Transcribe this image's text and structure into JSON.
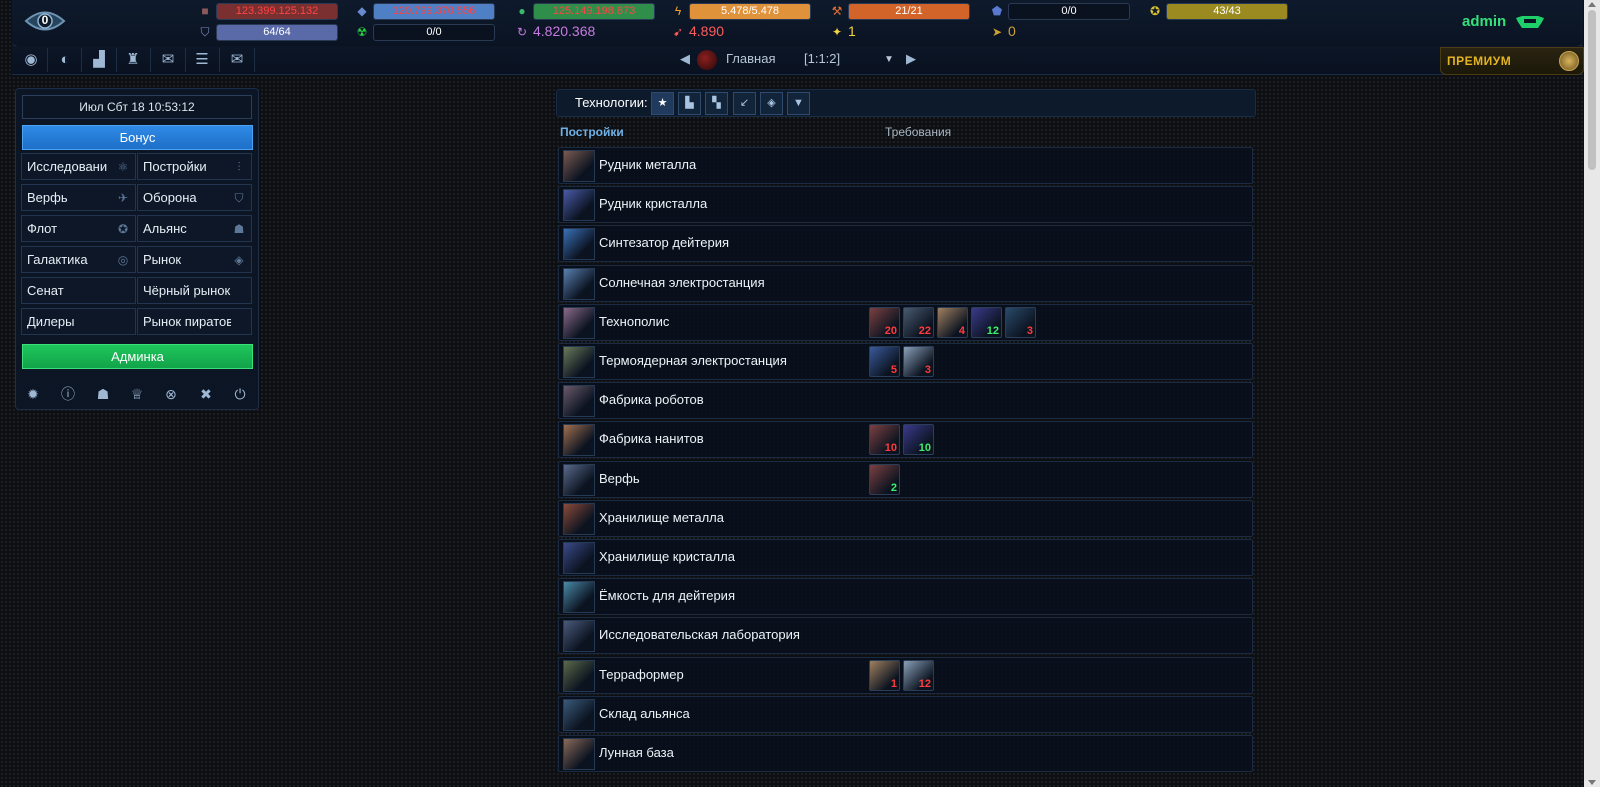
{
  "header": {
    "notifications": "0",
    "user": "admin",
    "resources_row1": [
      {
        "icon": "metal-icon",
        "text": "123.399.125.132",
        "color": "#ff4444",
        "fill": 1.0,
        "fill_color": "#7a3030"
      },
      {
        "icon": "crystal-icon",
        "text": "120.799.370.556",
        "color": "#ff4444",
        "fill": 1.0,
        "fill_color": "#4f7fc4"
      },
      {
        "icon": "deuterium-icon",
        "text": "125.149.198.873",
        "color": "#ff4444",
        "fill": 1.0,
        "fill_color": "#2f8f4a"
      },
      {
        "icon": "energy-icon",
        "text": "5.478/5.478",
        "color": "#ffffff",
        "fill": 1.0,
        "fill_color": "#e0923a"
      },
      {
        "icon": "fields-icon",
        "text": "21/21",
        "color": "#ffffff",
        "fill": 1.0,
        "fill_color": "#d2642a"
      },
      {
        "icon": "pentagon-icon",
        "text": "0/0",
        "color": "#ffffff",
        "fill": 0,
        "fill_color": "#1e2f4c"
      },
      {
        "icon": "target-icon",
        "text": "43/43",
        "color": "#ffffff",
        "fill": 1.0,
        "fill_color": "#9a8a1f"
      }
    ],
    "resources_row2": [
      {
        "icon": "shield-icon",
        "text": "64/64",
        "type": "bar",
        "fill": 1.0,
        "fill_color": "#5a6aa8",
        "color": "#ffffff"
      },
      {
        "icon": "radiation-icon",
        "text": "0/0",
        "type": "bar",
        "fill": 0,
        "fill_color": "#1e2f4c",
        "color": "#ffffff"
      },
      {
        "icon": "darkmatter-icon",
        "text": "4.820.368",
        "type": "plain",
        "color": "#c67be0"
      },
      {
        "icon": "rocket-icon",
        "text": "4.890",
        "type": "plain",
        "color": "#ff5a5a"
      },
      {
        "icon": "star-shard-icon",
        "text": "1",
        "type": "plain",
        "color": "#f2d240"
      },
      {
        "icon": "arrow-icon",
        "text": "0",
        "type": "plain",
        "color": "#d0a030"
      }
    ]
  },
  "nav": {
    "planet_name": "Главная",
    "planet_coords": "[1:1:2]",
    "premium": "ПРЕМИУМ"
  },
  "sidebar": {
    "datetime": "Июл Сбт 18 10:53:12",
    "bonus": "Бонус",
    "admin": "Админка",
    "menu": [
      {
        "label": "Исследовани",
        "icon": "research-icon"
      },
      {
        "label": "Постройки",
        "icon": "sliders-icon"
      },
      {
        "label": "Верфь",
        "icon": "ship-icon"
      },
      {
        "label": "Оборона",
        "icon": "shield-icon"
      },
      {
        "label": "Флот",
        "icon": "target-icon"
      },
      {
        "label": "Альянс",
        "icon": "group-icon"
      },
      {
        "label": "Галактика",
        "icon": "galaxy-icon"
      },
      {
        "label": "Рынок",
        "icon": "tag-icon"
      },
      {
        "label": "Сенат",
        "icon": ""
      },
      {
        "label": "Чёрный рынок",
        "icon": ""
      },
      {
        "label": "Дилеры",
        "icon": ""
      },
      {
        "label": "Рынок пиратов",
        "icon": ""
      }
    ]
  },
  "tech": {
    "label": "Технологии:",
    "col_buildings": "Постройки",
    "col_requirements": "Требования",
    "rows": [
      {
        "name": "Рудник металла",
        "color": "#7a5a50",
        "reqs": []
      },
      {
        "name": "Рудник кристалла",
        "color": "#4a5aa8",
        "reqs": []
      },
      {
        "name": "Синтезатор дейтерия",
        "color": "#3a70b8",
        "reqs": []
      },
      {
        "name": "Солнечная электростанция",
        "color": "#5a80b0",
        "reqs": []
      },
      {
        "name": "Технополис",
        "color": "#8a6a8a",
        "reqs": [
          {
            "level": "20",
            "ok": false,
            "color": "#7a4040"
          },
          {
            "level": "22",
            "ok": false,
            "color": "#4a5a70"
          },
          {
            "level": "4",
            "ok": false,
            "color": "#a08060"
          },
          {
            "level": "12",
            "ok": true,
            "color": "#3a3a8a"
          },
          {
            "level": "3",
            "ok": false,
            "color": "#2a4a6a"
          }
        ]
      },
      {
        "name": "Термоядерная электростанция",
        "color": "#6a7a5a",
        "reqs": [
          {
            "level": "5",
            "ok": false,
            "color": "#3a5a9a"
          },
          {
            "level": "3",
            "ok": false,
            "color": "#8aa0b8"
          }
        ]
      },
      {
        "name": "Фабрика роботов",
        "color": "#6a5a6a",
        "reqs": []
      },
      {
        "name": "Фабрика нанитов",
        "color": "#a07050",
        "reqs": [
          {
            "level": "10",
            "ok": false,
            "color": "#7a4040"
          },
          {
            "level": "10",
            "ok": true,
            "color": "#3a3a8a"
          }
        ]
      },
      {
        "name": "Верфь",
        "color": "#5a6a8a",
        "reqs": [
          {
            "level": "2",
            "ok": true,
            "color": "#7a4040"
          }
        ]
      },
      {
        "name": "Хранилище металла",
        "color": "#8a4a3a",
        "reqs": []
      },
      {
        "name": "Хранилище кристалла",
        "color": "#3a4a8a",
        "reqs": []
      },
      {
        "name": "Ёмкость для дейтерия",
        "color": "#4a8aa8",
        "reqs": []
      },
      {
        "name": "Исследовательская лаборатория",
        "color": "#4a5a7a",
        "reqs": []
      },
      {
        "name": "Терраформер",
        "color": "#5a6a4a",
        "reqs": [
          {
            "level": "1",
            "ok": false,
            "color": "#a08060"
          },
          {
            "level": "12",
            "ok": false,
            "color": "#8aa0b8"
          }
        ]
      },
      {
        "name": "Склад альянса",
        "color": "#3a5a7a",
        "reqs": []
      },
      {
        "name": "Лунная база",
        "color": "#8a6a5a",
        "reqs": []
      }
    ]
  }
}
